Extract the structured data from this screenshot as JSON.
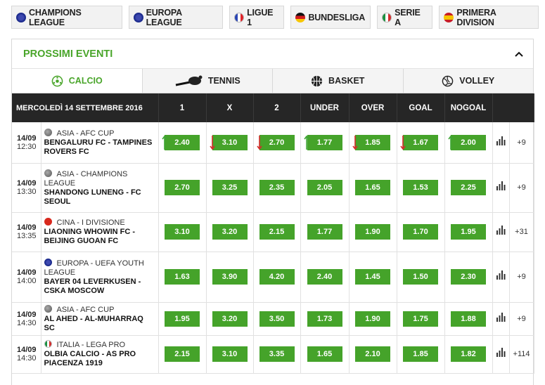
{
  "leagues": [
    {
      "label": "CHAMPIONS LEAGUE",
      "flag": "eu",
      "icon": "eu-flag-icon"
    },
    {
      "label": "EUROPA LEAGUE",
      "flag": "eu",
      "icon": "eu-flag-icon"
    },
    {
      "label": "LIGUE 1",
      "flag": "fr",
      "icon": "france-flag-icon"
    },
    {
      "label": "BUNDESLIGA",
      "flag": "de",
      "icon": "germany-flag-icon"
    },
    {
      "label": "SERIE A",
      "flag": "it",
      "icon": "italy-flag-icon"
    },
    {
      "label": "PRIMERA DIVISION",
      "flag": "es",
      "icon": "spain-flag-icon"
    }
  ],
  "panel": {
    "title": "PROSSIMI EVENTI",
    "collapse_icon": "chevron-up-icon"
  },
  "sports": [
    {
      "label": "CALCIO",
      "icon": "soccer-ball-icon",
      "active": true
    },
    {
      "label": "TENNIS",
      "icon": "tennis-racket-icon",
      "active": false
    },
    {
      "label": "BASKET",
      "icon": "basketball-icon",
      "active": false
    },
    {
      "label": "VOLLEY",
      "icon": "volleyball-icon",
      "active": false
    }
  ],
  "table": {
    "date_header": "MERCOLEDÌ 14 SETTEMBRE 2016",
    "columns": [
      "1",
      "X",
      "2",
      "UNDER",
      "OVER",
      "GOAL",
      "NOGOAL"
    ],
    "rows": [
      {
        "date": "14/09",
        "time": "12:30",
        "flag": "grey",
        "competition": "ASIA - AFC CUP",
        "match": "BENGALURU FC - TAMPINES ROVERS FC",
        "odds": [
          "2.40",
          "3.10",
          "2.70",
          "1.77",
          "1.85",
          "1.67",
          "2.00"
        ],
        "trends": [
          "up",
          "down",
          "down",
          "up",
          "down",
          "down",
          "up"
        ],
        "more": "+9"
      },
      {
        "date": "14/09",
        "time": "13:30",
        "flag": "grey",
        "competition": "ASIA - CHAMPIONS LEAGUE",
        "match": "SHANDONG LUNENG - FC SEOUL",
        "odds": [
          "2.70",
          "3.25",
          "2.35",
          "2.05",
          "1.65",
          "1.53",
          "2.25"
        ],
        "trends": [
          "",
          "",
          "",
          "",
          "",
          "",
          ""
        ],
        "more": "+9"
      },
      {
        "date": "14/09",
        "time": "13:35",
        "flag": "cn",
        "competition": "CINA - I DIVISIONE",
        "match": "LIAONING WHOWIN FC - BEIJING GUOAN FC",
        "odds": [
          "3.10",
          "3.20",
          "2.15",
          "1.77",
          "1.90",
          "1.70",
          "1.95"
        ],
        "trends": [
          "",
          "",
          "",
          "",
          "",
          "",
          ""
        ],
        "more": "+31"
      },
      {
        "date": "14/09",
        "time": "14:00",
        "flag": "eu",
        "competition": "EUROPA - UEFA YOUTH LEAGUE",
        "match": "BAYER 04 LEVERKUSEN - CSKA MOSCOW",
        "odds": [
          "1.63",
          "3.90",
          "4.20",
          "2.40",
          "1.45",
          "1.50",
          "2.30"
        ],
        "trends": [
          "",
          "",
          "",
          "",
          "",
          "",
          ""
        ],
        "more": "+9"
      },
      {
        "date": "14/09",
        "time": "14:30",
        "flag": "grey",
        "competition": "ASIA - AFC CUP",
        "match": "AL AHED - AL-MUHARRAQ SC",
        "odds": [
          "1.95",
          "3.20",
          "3.50",
          "1.73",
          "1.90",
          "1.75",
          "1.88"
        ],
        "trends": [
          "",
          "",
          "",
          "",
          "",
          "",
          ""
        ],
        "more": "+9"
      },
      {
        "date": "14/09",
        "time": "14:30",
        "flag": "it",
        "competition": "ITALIA - LEGA PRO",
        "match": "OLBIA CALCIO - AS PRO PIACENZA 1919",
        "odds": [
          "2.15",
          "3.10",
          "3.35",
          "1.65",
          "2.10",
          "1.85",
          "1.82"
        ],
        "trends": [
          "",
          "",
          "",
          "",
          "",
          "",
          ""
        ],
        "more": "+114"
      }
    ]
  },
  "colors": {
    "accent": "#49a52a",
    "odd_bg": "#45a32a",
    "header_bg": "#262626",
    "up": "#3fa535",
    "down": "#d52b2b"
  },
  "stats_icon": "bar-chart-icon"
}
